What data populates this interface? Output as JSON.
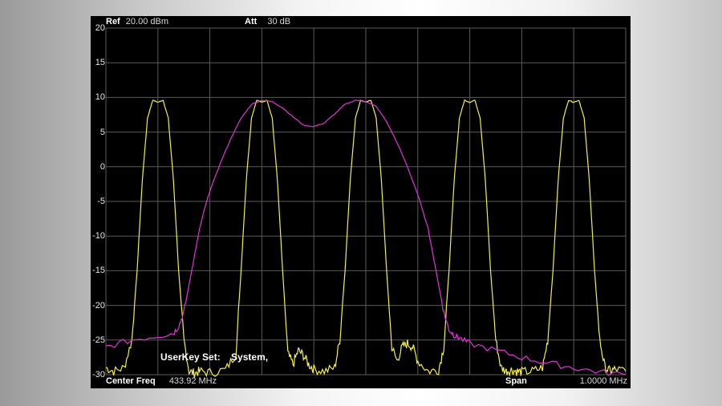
{
  "header": {
    "ref_label": "Ref",
    "ref_value": "20.00 dBm",
    "att_label": "Att",
    "att_value": "30 dB"
  },
  "overlay": {
    "userkey_label": "UserKey Set:",
    "userkey_value": "System,"
  },
  "footer": {
    "center_label": "Center Freq",
    "center_value": "433.92 MHz",
    "span_label": "Span",
    "span_value": "1.0000 MHz"
  },
  "colors": {
    "trace_yellow": "#f2ee4a",
    "trace_magenta": "#e032d8",
    "grid": "#5a5a5a",
    "background": "#000000"
  },
  "chart_data": {
    "type": "line",
    "ylim": [
      -30,
      20
    ],
    "xlim": [
      0,
      10
    ],
    "y_ticks": [
      "20",
      "15",
      "10",
      "5",
      "0",
      "-5",
      "-10",
      "-15",
      "-20",
      "-25",
      "-30"
    ],
    "x_divisions": 10,
    "grid": true,
    "series": [
      {
        "color": "#f2ee4a",
        "x": [
          0.0,
          0.15,
          0.35,
          0.5,
          0.6,
          0.7,
          0.8,
          0.9,
          1.0,
          1.1,
          1.2,
          1.3,
          1.4,
          1.5,
          1.6,
          1.7,
          1.8,
          2.0,
          2.3,
          2.5,
          2.6,
          2.7,
          2.8,
          2.9,
          3.0,
          3.1,
          3.2,
          3.3,
          3.4,
          3.5,
          3.6,
          3.7,
          3.8,
          3.9,
          4.0,
          4.2,
          4.4,
          4.5,
          4.6,
          4.7,
          4.8,
          4.9,
          5.0,
          5.1,
          5.2,
          5.3,
          5.4,
          5.5,
          5.6,
          5.7,
          5.8,
          5.9,
          6.0,
          6.2,
          6.4,
          6.5,
          6.6,
          6.7,
          6.8,
          6.9,
          7.0,
          7.1,
          7.2,
          7.3,
          7.4,
          7.5,
          7.6,
          7.7,
          7.8,
          7.9,
          8.0,
          8.2,
          8.4,
          8.5,
          8.6,
          8.7,
          8.8,
          8.9,
          9.0,
          9.1,
          9.2,
          9.3,
          9.4,
          9.5,
          9.6,
          9.7,
          9.8,
          10.0
        ],
        "y": [
          -29,
          -29.5,
          -29,
          -25,
          -15,
          -2,
          7,
          9.6,
          9.3,
          9.6,
          7,
          -2,
          -15,
          -25,
          -29.5,
          -29.8,
          -29.5,
          -29.7,
          -29.3,
          -27,
          -15,
          -2,
          7,
          9.6,
          9.3,
          9.6,
          7,
          -2,
          -15,
          -27,
          -28.5,
          -26.5,
          -27.2,
          -28.5,
          -29.2,
          -29.5,
          -29,
          -25,
          -15,
          -2,
          7,
          9.6,
          9.3,
          9.6,
          7,
          -2,
          -15,
          -26,
          -28,
          -26,
          -25.5,
          -26,
          -28,
          -29.5,
          -29.3,
          -26,
          -15,
          -2,
          7,
          9.6,
          9.3,
          9.6,
          7,
          -2,
          -15,
          -25,
          -29,
          -29.5,
          -29.3,
          -29.5,
          -29.6,
          -29.5,
          -29,
          -25,
          -15,
          -2,
          7,
          9.6,
          9.3,
          9.6,
          7,
          -2,
          -15,
          -25,
          -29,
          -29.5,
          -29.2,
          -29.5
        ]
      },
      {
        "color": "#e032d8",
        "x": [
          0.0,
          0.5,
          1.0,
          1.3,
          1.4,
          1.5,
          1.6,
          1.7,
          1.8,
          1.9,
          2.0,
          2.2,
          2.4,
          2.6,
          2.8,
          3.0,
          3.2,
          3.4,
          3.6,
          3.8,
          4.0,
          4.2,
          4.4,
          4.6,
          4.8,
          5.0,
          5.2,
          5.4,
          5.6,
          5.8,
          6.0,
          6.2,
          6.3,
          6.4,
          6.5,
          6.6,
          6.7,
          6.8,
          7.0,
          7.5,
          8.0,
          8.5,
          9.0,
          9.5,
          10.0
        ],
        "y": [
          -26,
          -25,
          -24.4,
          -24,
          -23,
          -21,
          -17,
          -13,
          -9,
          -6,
          -3.5,
          0.5,
          4,
          7,
          9,
          9.6,
          9.4,
          8.5,
          7.2,
          6,
          5.8,
          6.3,
          7.6,
          9,
          9.6,
          9.4,
          8.7,
          6.5,
          3.5,
          0,
          -4,
          -9,
          -13,
          -17,
          -21,
          -23.5,
          -24.3,
          -24.7,
          -25.5,
          -26.5,
          -27.5,
          -28.3,
          -29,
          -29.6,
          -30
        ]
      }
    ]
  }
}
